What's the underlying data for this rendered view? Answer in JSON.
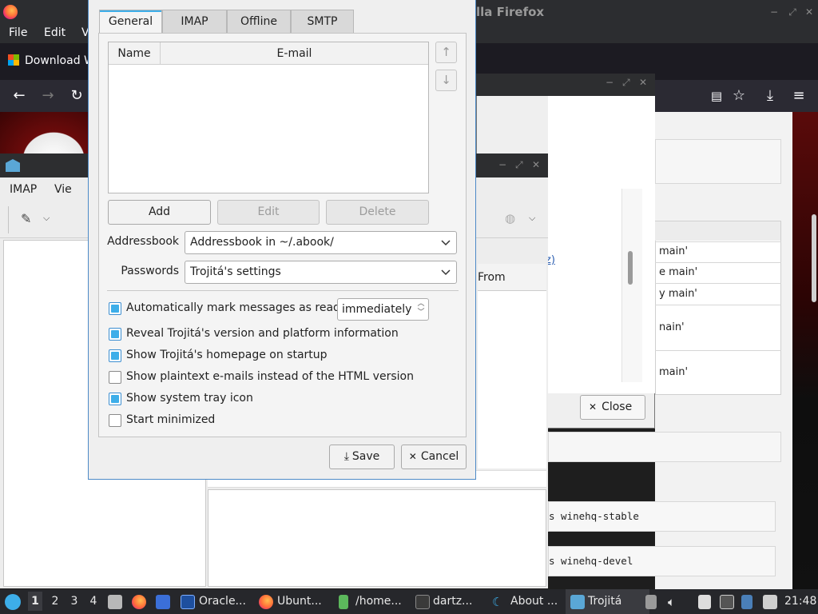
{
  "firefox": {
    "title_fragment": "lla Firefox",
    "menu": [
      "File",
      "Edit",
      "V"
    ],
    "tab_label": "Download W",
    "window_buttons": [
      "−",
      "⤢",
      "✕"
    ]
  },
  "background_page": {
    "link_fragment": "z)",
    "rows": [
      "main'",
      "e main'",
      "y main'",
      "nain'",
      "main'"
    ],
    "code": [
      "s winehq-stable",
      "s winehq-devel"
    ]
  },
  "secondary_dialog": {
    "close_label": "Close",
    "window_buttons": [
      "−",
      "⤢",
      "✕"
    ]
  },
  "trojita_main": {
    "menu": [
      "IMAP",
      "Vie"
    ],
    "from_header": "From",
    "window_buttons": [
      "−",
      "⤢",
      "✕"
    ]
  },
  "settings": {
    "tabs": [
      "General",
      "IMAP",
      "Offline",
      "SMTP"
    ],
    "active_tab": "General",
    "identities": {
      "columns": [
        "Name",
        "E-mail"
      ],
      "rows": []
    },
    "buttons": {
      "add": "Add",
      "edit": "Edit",
      "delete": "Delete"
    },
    "addressbook": {
      "label": "Addressbook",
      "value": "Addressbook in ~/.abook/"
    },
    "passwords": {
      "label": "Passwords",
      "value": "Trojitá's settings"
    },
    "mark_read": {
      "label": "Automatically mark messages as read",
      "checked": true,
      "value": "immediately"
    },
    "checkboxes": [
      {
        "label": "Reveal Trojitá's version and platform information",
        "checked": true
      },
      {
        "label": "Show Trojitá's homepage on startup",
        "checked": true
      },
      {
        "label": "Show plaintext e-mails instead of the HTML version",
        "checked": false
      },
      {
        "label": "Show system tray icon",
        "checked": true
      },
      {
        "label": "Start minimized",
        "checked": false
      }
    ],
    "save": "Save",
    "cancel": "Cancel"
  },
  "taskbar": {
    "workspaces": [
      "1",
      "2",
      "3",
      "4"
    ],
    "tasks": [
      "Oracle...",
      "Ubunt...",
      "/home...",
      "dartz...",
      "About ...",
      "Trojitá"
    ],
    "clock": "21:48"
  },
  "colors": {
    "accent": "#3daee9",
    "dialog_bg": "#efefef",
    "taskbar": "#26272b",
    "firefox_chrome": "#2b2a33"
  }
}
